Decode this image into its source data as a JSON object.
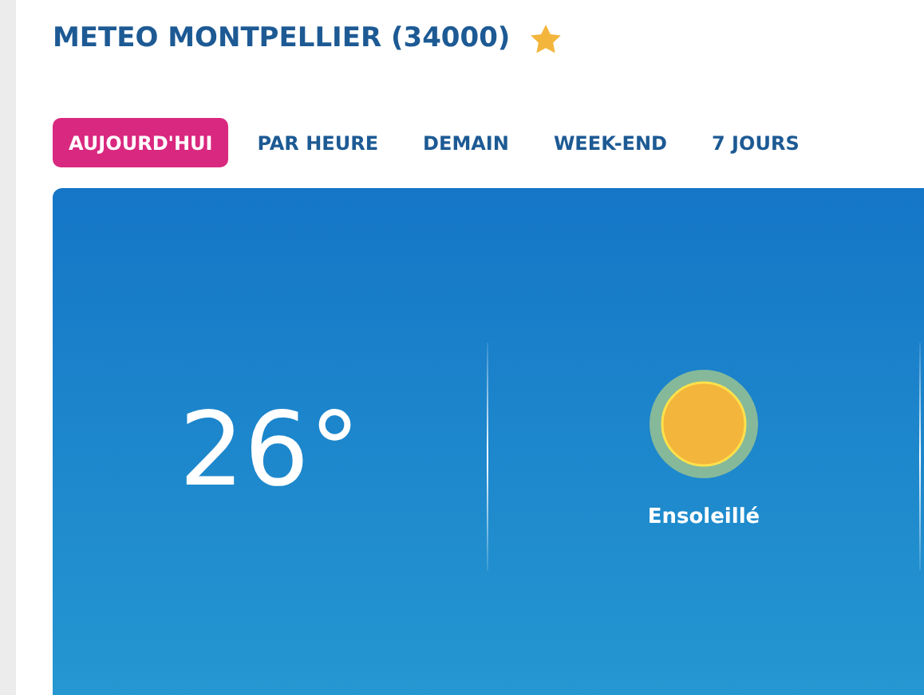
{
  "header": {
    "title": "METEO MONTPELLIER (34000)",
    "favorite": true
  },
  "tabs": [
    {
      "label": "AUJOURD'HUI",
      "selected": true
    },
    {
      "label": "PAR HEURE",
      "selected": false
    },
    {
      "label": "DEMAIN",
      "selected": false
    },
    {
      "label": "WEEK-END",
      "selected": false
    },
    {
      "label": "7 JOURS",
      "selected": false
    }
  ],
  "current": {
    "temperature": "26°",
    "condition": "Ensoleillé"
  }
}
